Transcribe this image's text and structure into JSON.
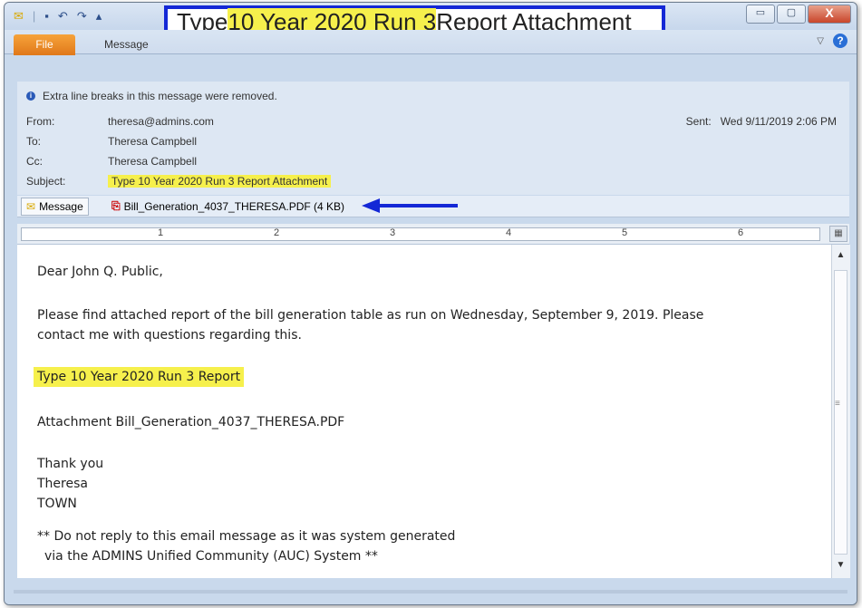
{
  "window": {
    "title_parts": [
      "Type ",
      "10 Year 2020 Run 3",
      " Report Attachment"
    ],
    "minimize": "▭",
    "maximize": "▢",
    "close": "X"
  },
  "quick_access": {
    "mail": "✉",
    "save": "▪",
    "undo": "↶",
    "redo": "↷",
    "up": "▴"
  },
  "ribbon": {
    "file_tab": "File",
    "message_tab": "Message"
  },
  "header": {
    "info": "Extra line breaks in this message were removed.",
    "from_label": "From:",
    "from_value": "theresa@admins.com",
    "to_label": "To:",
    "to_value": "Theresa Campbell",
    "cc_label": "Cc:",
    "cc_value": "Theresa Campbell",
    "subject_label": "Subject:",
    "subject_value": "Type 10 Year 2020 Run 3 Report Attachment",
    "sent_label": "Sent:",
    "sent_value": "Wed 9/11/2019 2:06 PM"
  },
  "attachments": {
    "message_button": "Message",
    "file": "Bill_Generation_4037_THERESA.PDF (4 KB)"
  },
  "ruler": {
    "numbers": [
      "1",
      "2",
      "3",
      "4",
      "5",
      "6"
    ]
  },
  "body": {
    "greeting": "Dear John Q. Public,",
    "line1": "Please find attached report of the bill generation table as run on Wednesday, September 9, 2019. Please",
    "line2": "contact me with questions regarding this.",
    "highlight": "Type 10 Year 2020 Run 3 Report",
    "attachment_line": "Attachment Bill_Generation_4037_THERESA.PDF",
    "thanks": "Thank you",
    "name": "Theresa",
    "org": "TOWN",
    "footer1": "** Do not reply to this email message as it was system generated",
    "footer2": "via the ADMINS Unified Community (AUC) System **"
  },
  "colors": {
    "highlight": "#f6f04c",
    "title_border": "#1428d6",
    "arrow": "#1428d6"
  }
}
